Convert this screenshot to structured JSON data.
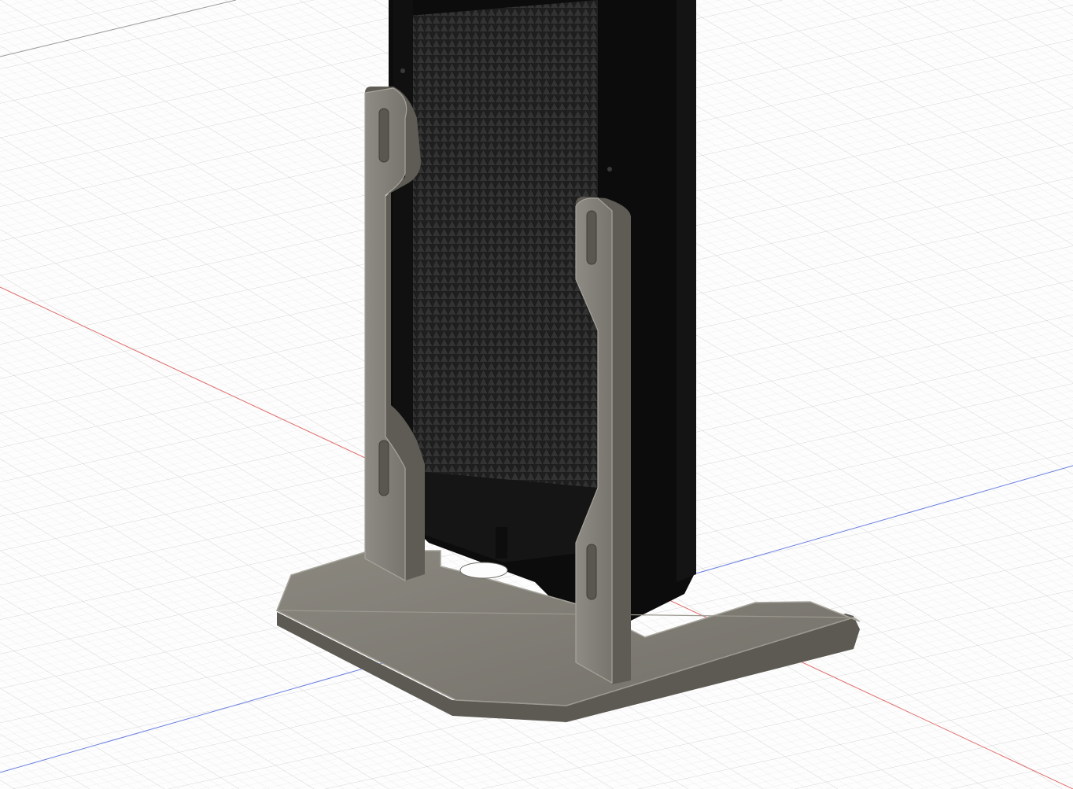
{
  "app": {
    "view": "3d-viewport",
    "projection": "isometric"
  },
  "scene": {
    "background_color": "#fdfdfd",
    "grid": {
      "visible": true,
      "minor_color": "#e3e3e3",
      "major_color": "#cfcfcf"
    },
    "axes": {
      "x_axis": {
        "visible": true,
        "color": "#e06a6a"
      },
      "y_axis": {
        "visible": true,
        "color": "#6a7fe0"
      }
    },
    "model": {
      "radiator": {
        "visible": true,
        "body_color": "#1d1d1d",
        "fin_color": "#2a2a2a",
        "frame_color": "#0c0c0c"
      },
      "stand": {
        "visible": true,
        "plate_color": "#7d7a73",
        "edge_color": "#a7a49c",
        "shadow_color": "#5d5a54"
      }
    }
  }
}
